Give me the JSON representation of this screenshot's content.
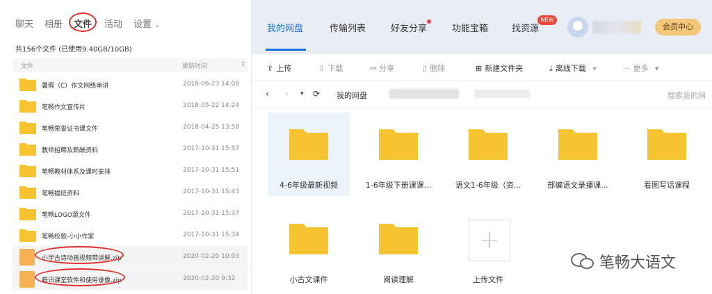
{
  "left": {
    "tabs": [
      "聊天",
      "相册",
      "文件",
      "活动",
      "设置"
    ],
    "active_tab": "文件",
    "storage_text": "共156个文件 (已使用9.40GB/10GB)",
    "columns": [
      "文件",
      "更新时间"
    ],
    "files": [
      {
        "name": "暑假（C）作文网络串讲",
        "date": "2018-06-23 14:09"
      },
      {
        "name": "笔畅作文宣传片",
        "date": "2018-05-22 14:24"
      },
      {
        "name": "笔畅荣誉证书课文件",
        "date": "2018-04-25 13:58"
      },
      {
        "name": "教师招聘及薪酬资料",
        "date": "2017-10-31 15:57"
      },
      {
        "name": "笔畅教材体系及课时安排",
        "date": "2017-10-31 15:51"
      },
      {
        "name": "笔畅插班资料",
        "date": "2017-10-31 15:43"
      },
      {
        "name": "笔畅LOGO源文件",
        "date": "2017-10-31 15:37"
      },
      {
        "name": "笔畅校歌-小小作家",
        "date": "2017-10-31 15:34"
      },
      {
        "name": "小学古诗动画视频带讲解.zip",
        "date": "2020-02-20 10:03"
      },
      {
        "name": "腾讯课堂软件和使用录像.zip",
        "date": "2020-02-20 9:32"
      }
    ]
  },
  "right": {
    "tabs": [
      "我的网盘",
      "传输列表",
      "好友分享",
      "功能宝箱",
      "找资源"
    ],
    "new_badge": "NEW",
    "vip_label": "会员中心",
    "toolbar": {
      "upload": "上传",
      "download": "下载",
      "share": "分享",
      "delete": "删除",
      "new_folder": "新建文件夹",
      "offline": "离线下载",
      "more": "更多"
    },
    "breadcrumb": "我的网盘",
    "search_placeholder": "搜索我的网",
    "folders": [
      {
        "label": "4-6年级最新视频"
      },
      {
        "label": "1-6年级下册课课..."
      },
      {
        "label": "语文1-6年级（资..."
      },
      {
        "label": "部编语文录播课..."
      },
      {
        "label": "看图写话课程"
      },
      {
        "label": "小古文课件"
      },
      {
        "label": "阅读理解"
      }
    ],
    "upload_tile_label": "上传文件"
  },
  "watermark": "笔畅大语文",
  "colors": {
    "accent": "#1b6fd8",
    "folder": "#f7c431",
    "highlight_red": "#e0302b",
    "vip_gold": "#f2c77a"
  }
}
